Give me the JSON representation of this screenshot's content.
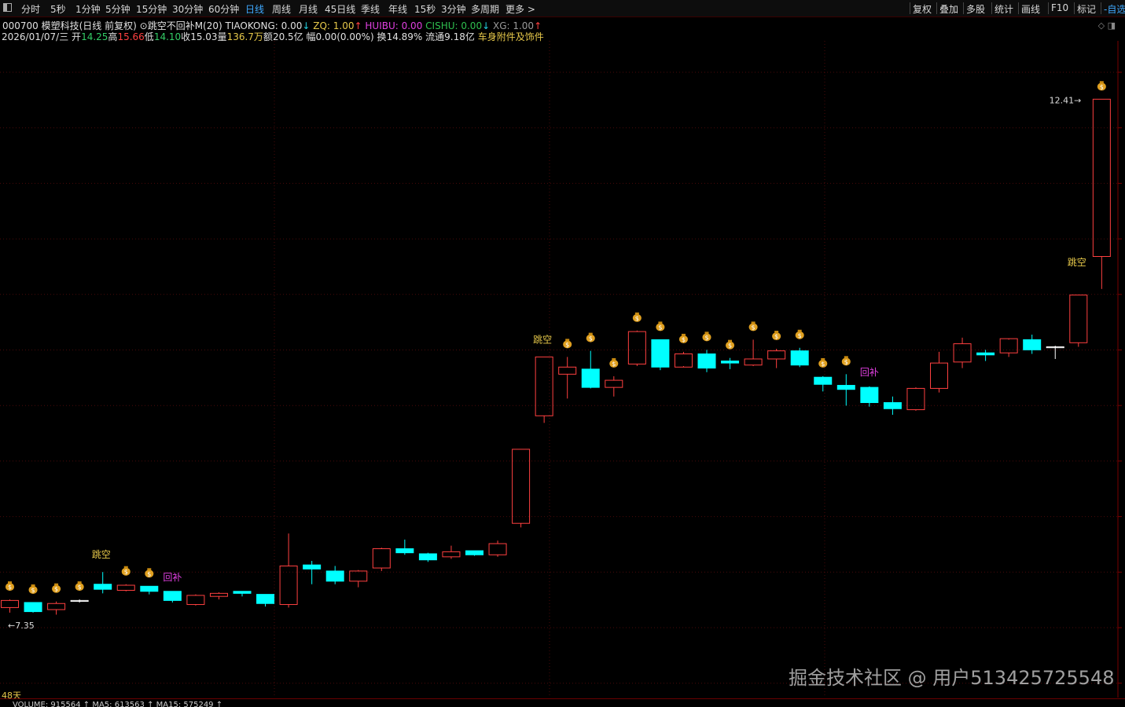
{
  "toolbar": {
    "periods": [
      "分时",
      "5秒",
      "1分钟",
      "5分钟",
      "15分钟",
      "30分钟",
      "60分钟",
      "日线",
      "周线",
      "月线",
      "45日线",
      "季线",
      "年线",
      "15秒",
      "3分钟",
      "多周期",
      "更多 >"
    ],
    "active_period": "日线",
    "right_items": [
      "复权",
      "叠加",
      "多股",
      "统计",
      "画线",
      "F10",
      "标记",
      "-自选"
    ]
  },
  "info_line1": {
    "code_name": "000700 模塑科技(日线 前复权)",
    "indicator": "跳空不回补M(20)",
    "tiaokong": "TIAOKONG: 0.00",
    "tiaokong_arrow": "↓",
    "zq": "ZQ: 1.00",
    "zq_arrow": "↑",
    "huibu": "HUIBU: 0.00",
    "cishu": "CISHU: 0.00",
    "cishu_arrow": "↓",
    "xg": "XG: 1.00",
    "xg_arrow": "↑"
  },
  "info_line2": {
    "date": "2026/01/07/三",
    "open_label": "开",
    "open": "14.25",
    "high_label": "高",
    "high": "15.66",
    "low_label": "低",
    "low": "14.10",
    "close_label": "收",
    "close": "15.03",
    "vol_label": "量",
    "vol": "136.7万",
    "amount_label": "额",
    "amount": "20.5亿",
    "change_label": "幅",
    "change": "0.00(0.00%)",
    "turnover_label": "换",
    "turnover": "14.89%",
    "float_label": "流通",
    "float": "9.18亿",
    "sector": "车身附件及饰件"
  },
  "chart_data": {
    "type": "candlestick",
    "price_range": [
      6.9,
      12.9
    ],
    "max_label": "12.41",
    "min_label": "7.35",
    "colors": {
      "up": "#ff4040",
      "down": "#00ffff",
      "flat": "#ffffff",
      "gap_label": "#e6c84a",
      "fill_label": "#e040e0"
    },
    "candles": [
      {
        "o": 7.4,
        "h": 7.48,
        "l": 7.35,
        "c": 7.47
      },
      {
        "o": 7.45,
        "h": 7.45,
        "l": 7.35,
        "c": 7.36
      },
      {
        "o": 7.38,
        "h": 7.46,
        "l": 7.33,
        "c": 7.44
      },
      {
        "o": 7.47,
        "h": 7.48,
        "l": 7.45,
        "c": 7.47
      },
      {
        "o": 7.63,
        "h": 7.75,
        "l": 7.54,
        "c": 7.58
      },
      {
        "o": 7.57,
        "h": 7.63,
        "l": 7.56,
        "c": 7.62
      },
      {
        "o": 7.61,
        "h": 7.61,
        "l": 7.53,
        "c": 7.56
      },
      {
        "o": 7.56,
        "h": 7.56,
        "l": 7.45,
        "c": 7.47
      },
      {
        "o": 7.43,
        "h": 7.53,
        "l": 7.42,
        "c": 7.52
      },
      {
        "o": 7.51,
        "h": 7.55,
        "l": 7.48,
        "c": 7.54
      },
      {
        "o": 7.56,
        "h": 7.56,
        "l": 7.51,
        "c": 7.54
      },
      {
        "o": 7.53,
        "h": 7.53,
        "l": 7.41,
        "c": 7.44
      },
      {
        "o": 7.43,
        "h": 8.13,
        "l": 7.4,
        "c": 7.81
      },
      {
        "o": 7.82,
        "h": 7.86,
        "l": 7.63,
        "c": 7.78
      },
      {
        "o": 7.76,
        "h": 7.81,
        "l": 7.63,
        "c": 7.66
      },
      {
        "o": 7.66,
        "h": 7.77,
        "l": 7.6,
        "c": 7.76
      },
      {
        "o": 7.79,
        "h": 7.99,
        "l": 7.76,
        "c": 7.98
      },
      {
        "o": 7.98,
        "h": 8.07,
        "l": 7.92,
        "c": 7.94
      },
      {
        "o": 7.93,
        "h": 7.94,
        "l": 7.85,
        "c": 7.87
      },
      {
        "o": 7.9,
        "h": 8.01,
        "l": 7.88,
        "c": 7.95
      },
      {
        "o": 7.96,
        "h": 7.96,
        "l": 7.91,
        "c": 7.92
      },
      {
        "o": 7.92,
        "h": 8.06,
        "l": 7.9,
        "c": 8.03
      },
      {
        "o": 8.23,
        "h": 8.96,
        "l": 8.19,
        "c": 8.96
      },
      {
        "o": 9.29,
        "h": 9.87,
        "l": 9.22,
        "c": 9.87
      },
      {
        "o": 9.7,
        "h": 9.87,
        "l": 9.46,
        "c": 9.77
      },
      {
        "o": 9.75,
        "h": 9.93,
        "l": 9.56,
        "c": 9.57
      },
      {
        "o": 9.57,
        "h": 9.68,
        "l": 9.48,
        "c": 9.64
      },
      {
        "o": 9.8,
        "h": 10.13,
        "l": 9.78,
        "c": 10.12
      },
      {
        "o": 10.04,
        "h": 10.04,
        "l": 9.74,
        "c": 9.77
      },
      {
        "o": 9.77,
        "h": 9.92,
        "l": 9.78,
        "c": 9.9
      },
      {
        "o": 9.9,
        "h": 9.94,
        "l": 9.72,
        "c": 9.76
      },
      {
        "o": 9.83,
        "h": 9.86,
        "l": 9.75,
        "c": 9.81
      },
      {
        "o": 9.79,
        "h": 10.04,
        "l": 9.78,
        "c": 9.85
      },
      {
        "o": 9.85,
        "h": 9.95,
        "l": 9.76,
        "c": 9.93
      },
      {
        "o": 9.93,
        "h": 9.96,
        "l": 9.77,
        "c": 9.79
      },
      {
        "o": 9.67,
        "h": 9.68,
        "l": 9.53,
        "c": 9.6
      },
      {
        "o": 9.59,
        "h": 9.7,
        "l": 9.39,
        "c": 9.55
      },
      {
        "o": 9.57,
        "h": 9.58,
        "l": 9.38,
        "c": 9.42
      },
      {
        "o": 9.42,
        "h": 9.48,
        "l": 9.3,
        "c": 9.36
      },
      {
        "o": 9.35,
        "h": 9.57,
        "l": 9.34,
        "c": 9.56
      },
      {
        "o": 9.56,
        "h": 9.92,
        "l": 9.52,
        "c": 9.81
      },
      {
        "o": 9.82,
        "h": 10.06,
        "l": 9.76,
        "c": 10.0
      },
      {
        "o": 9.91,
        "h": 9.94,
        "l": 9.83,
        "c": 9.89
      },
      {
        "o": 9.91,
        "h": 10.04,
        "l": 9.87,
        "c": 10.05
      },
      {
        "o": 10.04,
        "h": 10.09,
        "l": 9.9,
        "c": 9.94
      },
      {
        "o": 9.97,
        "h": 9.98,
        "l": 9.85,
        "c": 9.97
      },
      {
        "o": 10.01,
        "h": 10.48,
        "l": 9.97,
        "c": 10.48
      },
      {
        "o": 10.86,
        "h": 12.41,
        "l": 10.54,
        "c": 12.41
      }
    ],
    "money_bag_indices": [
      0,
      1,
      2,
      3,
      5,
      6,
      24,
      25,
      26,
      27,
      28,
      29,
      30,
      31,
      32,
      33,
      34,
      35,
      36,
      47
    ],
    "gap_labels": [
      {
        "index": 4,
        "text": "跳空"
      },
      {
        "index": 23,
        "text": "跳空"
      },
      {
        "index": 46,
        "text": "跳空"
      }
    ],
    "fill_labels": [
      {
        "index": 7,
        "text": "回补"
      },
      {
        "index": 37,
        "text": "回补"
      }
    ]
  },
  "bottom": {
    "days_label": "48天",
    "volume_text": "VOLUME: 915564 ↑ MA5: 613563 ↑ MA15: 575249 ↑"
  },
  "watermark": "掘金技术社区 @ 用户513425725548"
}
